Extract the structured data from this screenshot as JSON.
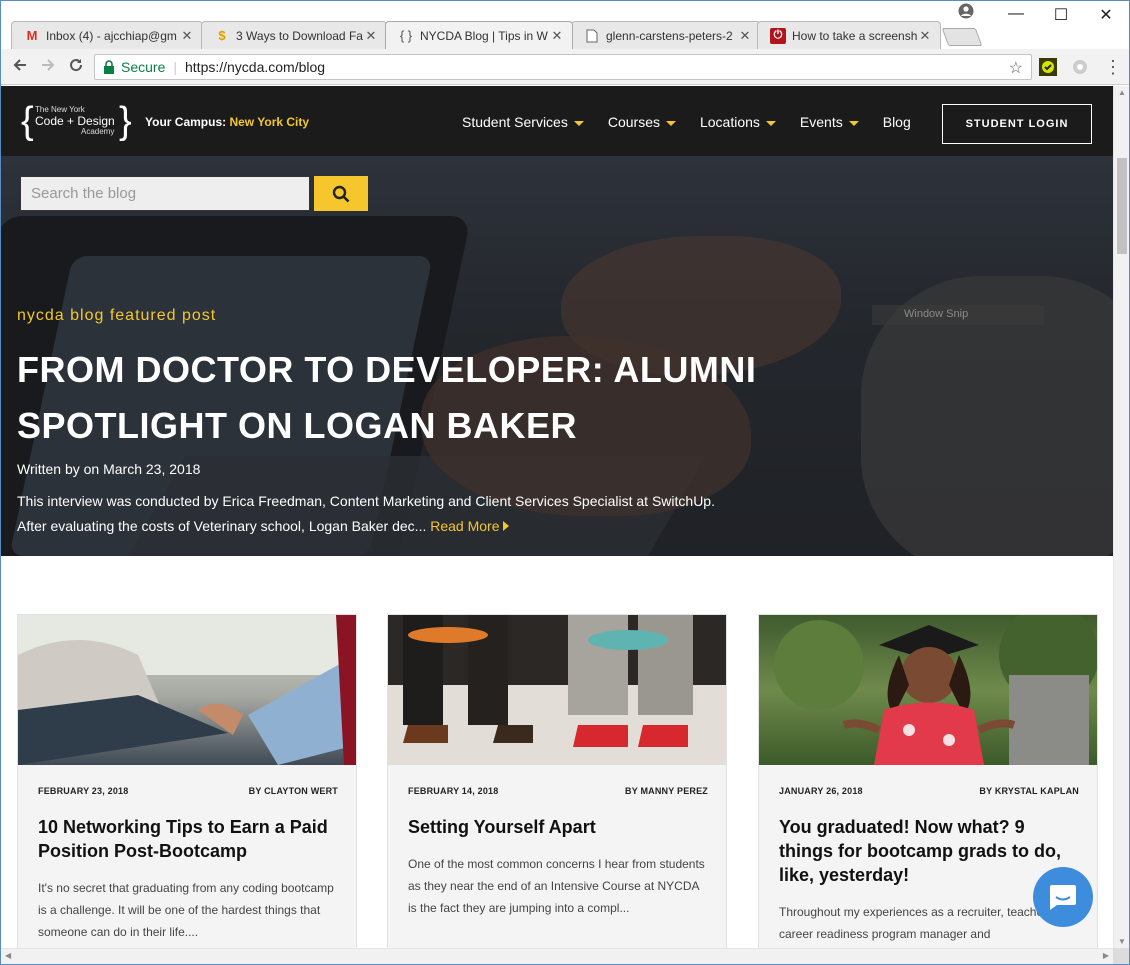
{
  "browser": {
    "tabs": [
      {
        "title": "Inbox (4) - ajcchiap@gm",
        "icon": "gmail-icon"
      },
      {
        "title": "3 Ways to Download Fa",
        "icon": "dollar-icon"
      },
      {
        "title": "NYCDA Blog | Tips in W",
        "icon": "braces-icon"
      },
      {
        "title": "glenn-carstens-peters-2",
        "icon": "document-icon"
      },
      {
        "title": "How to take a screensh",
        "icon": "power-icon"
      }
    ],
    "active_tab_index": 2,
    "close_glyph": "✕",
    "url_secure_label": "Secure",
    "url": "https://nycda.com/blog",
    "window_controls": {
      "minimize": "—",
      "maximize": "☐",
      "close": "✕"
    }
  },
  "site": {
    "logo": {
      "line1": "The New York",
      "line2": "Code + Design",
      "line3": "Academy"
    },
    "campus_label": "Your Campus:",
    "campus_city": "New York City",
    "nav": [
      {
        "label": "Student Services",
        "dropdown": true
      },
      {
        "label": "Courses",
        "dropdown": true
      },
      {
        "label": "Locations",
        "dropdown": true
      },
      {
        "label": "Events",
        "dropdown": true
      },
      {
        "label": "Blog",
        "dropdown": false
      }
    ],
    "login_label": "STUDENT LOGIN",
    "accent_color": "#f5c72d"
  },
  "hero": {
    "search_placeholder": "Search the blog",
    "featured_label": "nycda blog featured post",
    "title": "FROM DOCTOR TO DEVELOPER: ALUMNI SPOTLIGHT ON LOGAN BAKER",
    "byline": "Written by on March 23, 2018",
    "excerpt": "This interview was conducted by Erica Freedman, Content Marketing and Client Services Specialist at SwitchUp. After evaluating the costs of Veterinary school, Logan Baker dec...",
    "read_more": "Read More",
    "overlay_text": "Window Snip"
  },
  "posts": [
    {
      "date": "FEBRUARY 23, 2018",
      "author": "BY CLAYTON WERT",
      "title": "10 Networking Tips to Earn a Paid Position Post-Bootcamp",
      "excerpt": "It's no secret that graduating from any coding bootcamp is a challenge. It will be one of the hardest things that someone can do in their life...."
    },
    {
      "date": "FEBRUARY 14, 2018",
      "author": "BY MANNY PEREZ",
      "title": "Setting Yourself Apart",
      "excerpt": "One of the most common concerns I hear from students as they near the end of an Intensive Course at NYCDA is the fact they are jumping into a compl..."
    },
    {
      "date": "JANUARY 26, 2018",
      "author": "BY KRYSTAL KAPLAN",
      "title": "You graduated! Now what? 9 things for bootcamp grads to do, like, yesterday!",
      "excerpt": "Throughout my experiences as a recruiter, teacher, career readiness program manager and"
    }
  ]
}
